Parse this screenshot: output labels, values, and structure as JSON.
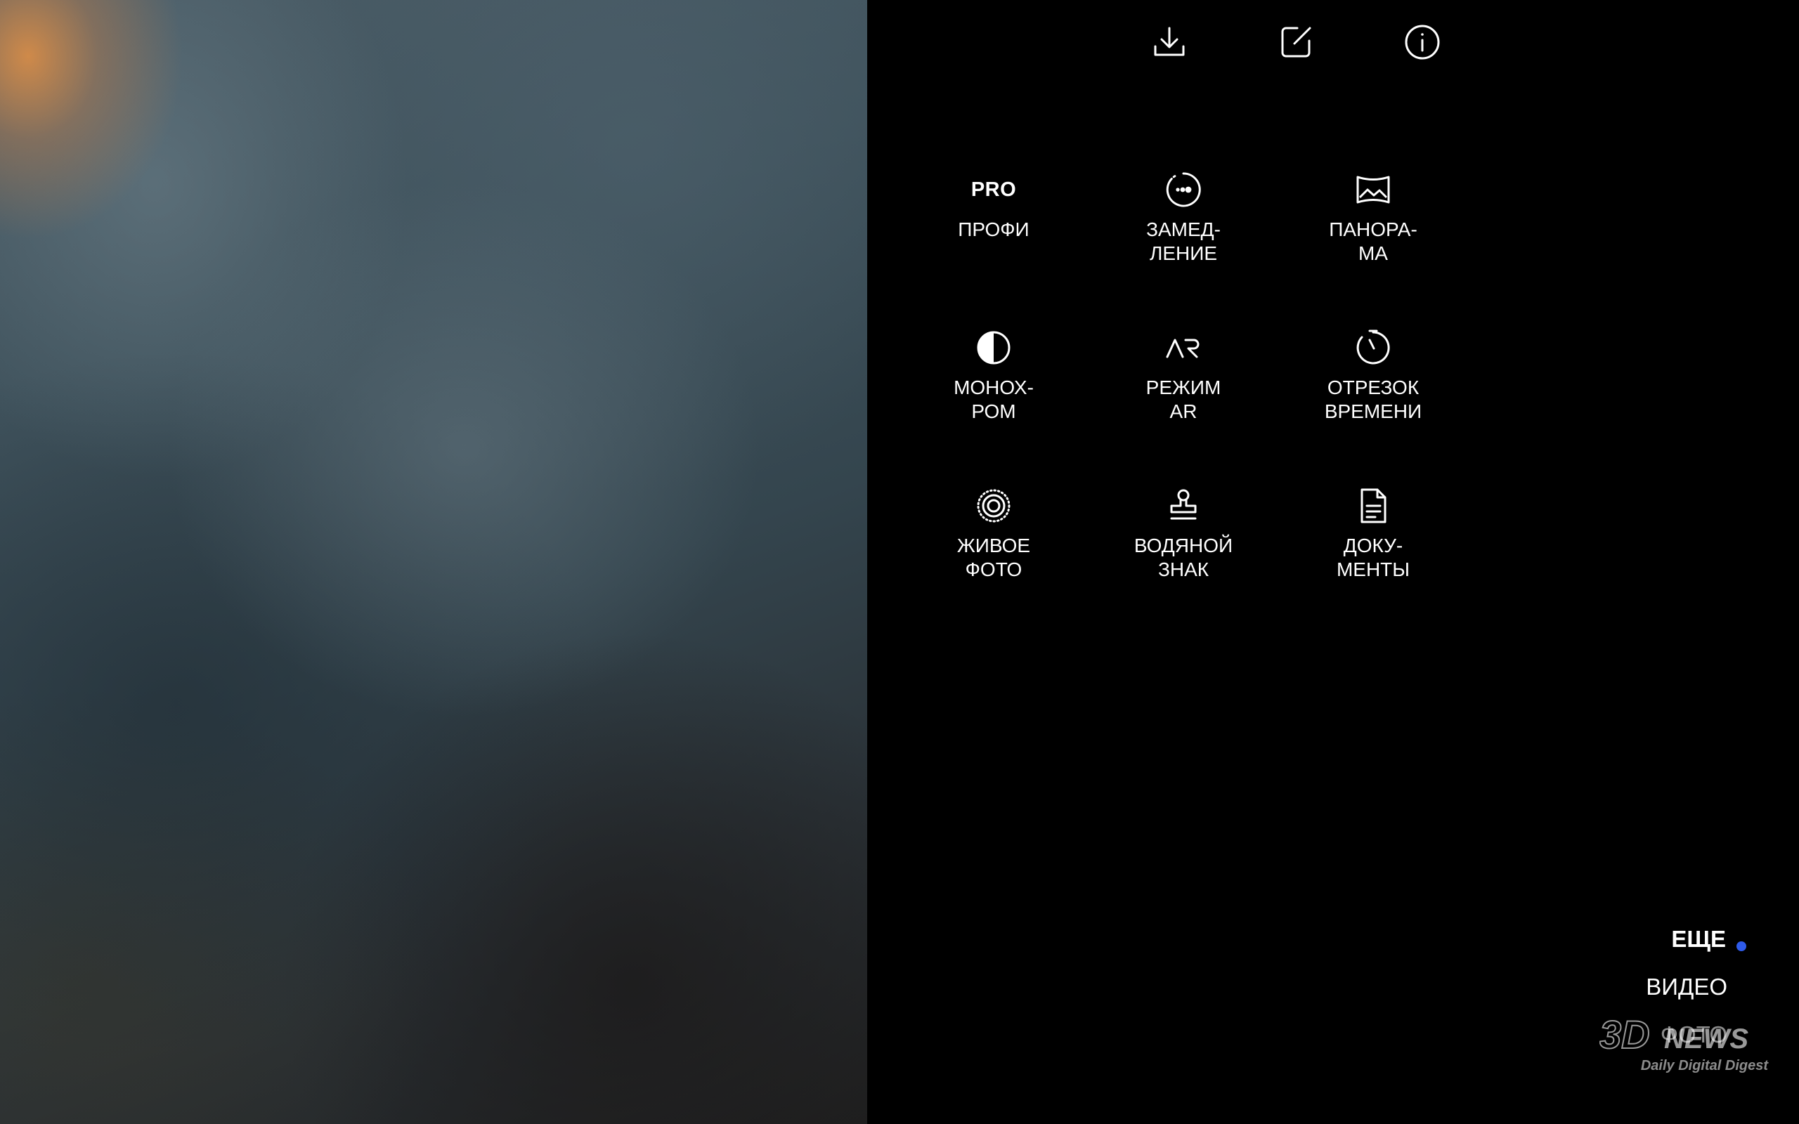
{
  "top_bar": {
    "icons": [
      "download-icon",
      "edit-note-icon",
      "info-icon"
    ]
  },
  "modes": [
    {
      "icon": "pro-text",
      "icon_text": "PRO",
      "label": "ПРОФИ"
    },
    {
      "icon": "slow-motion-icon",
      "label": "ЗАМЕД-\nЛЕНИЕ"
    },
    {
      "icon": "panorama-icon",
      "label": "ПАНОРА-\nМА"
    },
    {
      "icon": "monochrome-icon",
      "label": "МОНОХ-\nРОМ"
    },
    {
      "icon": "ar-icon",
      "label": "РЕЖИМ\nAR"
    },
    {
      "icon": "timer-icon",
      "label": "ОТРЕЗОК\nВРЕМЕНИ"
    },
    {
      "icon": "live-photo-icon",
      "label": "ЖИВОЕ\nФОТО"
    },
    {
      "icon": "stamp-icon",
      "label": "ВОДЯНОЙ\nЗНАК"
    },
    {
      "icon": "document-icon",
      "label": "ДОКУ-\nМЕНТЫ"
    }
  ],
  "mode_switcher": {
    "items": [
      "ЕЩЕ",
      "ВИДЕО",
      "ФОТО"
    ],
    "active": "ЕЩЕ",
    "active_dot_color": "#2f5bea"
  },
  "watermark": {
    "logo_text": "3DNEWS",
    "tagline": "Daily Digital Digest"
  },
  "colors": {
    "panel_background": "#000000",
    "text": "#ffffff",
    "accent": "#2f5bea"
  }
}
